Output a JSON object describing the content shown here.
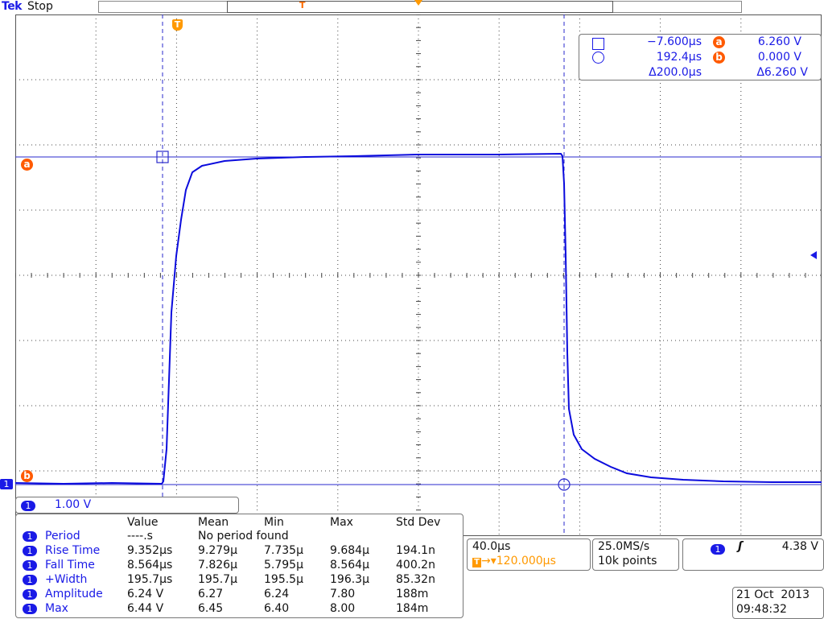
{
  "header": {
    "brand": "Tek",
    "run_state": "Stop",
    "trigger_marker": "T",
    "trigger_position_icon": "orange-down-triangle"
  },
  "cursor_readout": {
    "square_time": "−7.600µs",
    "circle_time": "192.4µs",
    "delta_time": "Δ200.0µs",
    "a_label": "a",
    "a_value": "6.260 V",
    "b_label": "b",
    "b_value": "0.000 V",
    "delta_value": "Δ6.260 V"
  },
  "markers": {
    "cursor_a": "a",
    "cursor_b": "b",
    "ch1_ground": "1",
    "trigger_t": "T"
  },
  "channel": {
    "number": "1",
    "scale": "1.00 V",
    "color": "#1a1ae6"
  },
  "measurements": {
    "headers": [
      "Value",
      "Mean",
      "Min",
      "Max",
      "Std Dev"
    ],
    "rows": [
      {
        "name": "Period",
        "value": "----.s",
        "mean": "No period found",
        "min": "",
        "max": "",
        "std": ""
      },
      {
        "name": "Rise Time",
        "value": "9.352µs",
        "mean": "9.279µ",
        "min": "7.735µ",
        "max": "9.684µ",
        "std": "194.1n"
      },
      {
        "name": "Fall Time",
        "value": "8.564µs",
        "mean": "7.826µ",
        "min": "5.795µ",
        "max": "8.564µ",
        "std": "400.2n"
      },
      {
        "name": "+Width",
        "value": "195.7µs",
        "mean": "195.7µ",
        "min": "195.5µ",
        "max": "196.3µ",
        "std": "85.32n"
      },
      {
        "name": "Amplitude",
        "value": "6.24 V",
        "mean": "6.27",
        "min": "6.24",
        "max": "7.80",
        "std": "188m"
      },
      {
        "name": "Max",
        "value": "6.44 V",
        "mean": "6.45",
        "min": "6.40",
        "max": "8.00",
        "std": "184m"
      }
    ]
  },
  "timebase": {
    "horizontal_scale": "40.0µs",
    "trigger_delay": "120.000µs"
  },
  "acquisition": {
    "sample_rate": "25.0MS/s",
    "record_length": "10k points"
  },
  "trigger": {
    "source": "1",
    "slope_icon": "rising-edge-icon",
    "level": "4.38 V"
  },
  "datetime": {
    "date": "21 Oct  2013",
    "time": "09:48:32"
  },
  "colors": {
    "waveform": "#0b0bdd",
    "cursor_badge": "#ff5a00",
    "trigger_orange": "#ff9900",
    "grid": "#333333"
  }
}
